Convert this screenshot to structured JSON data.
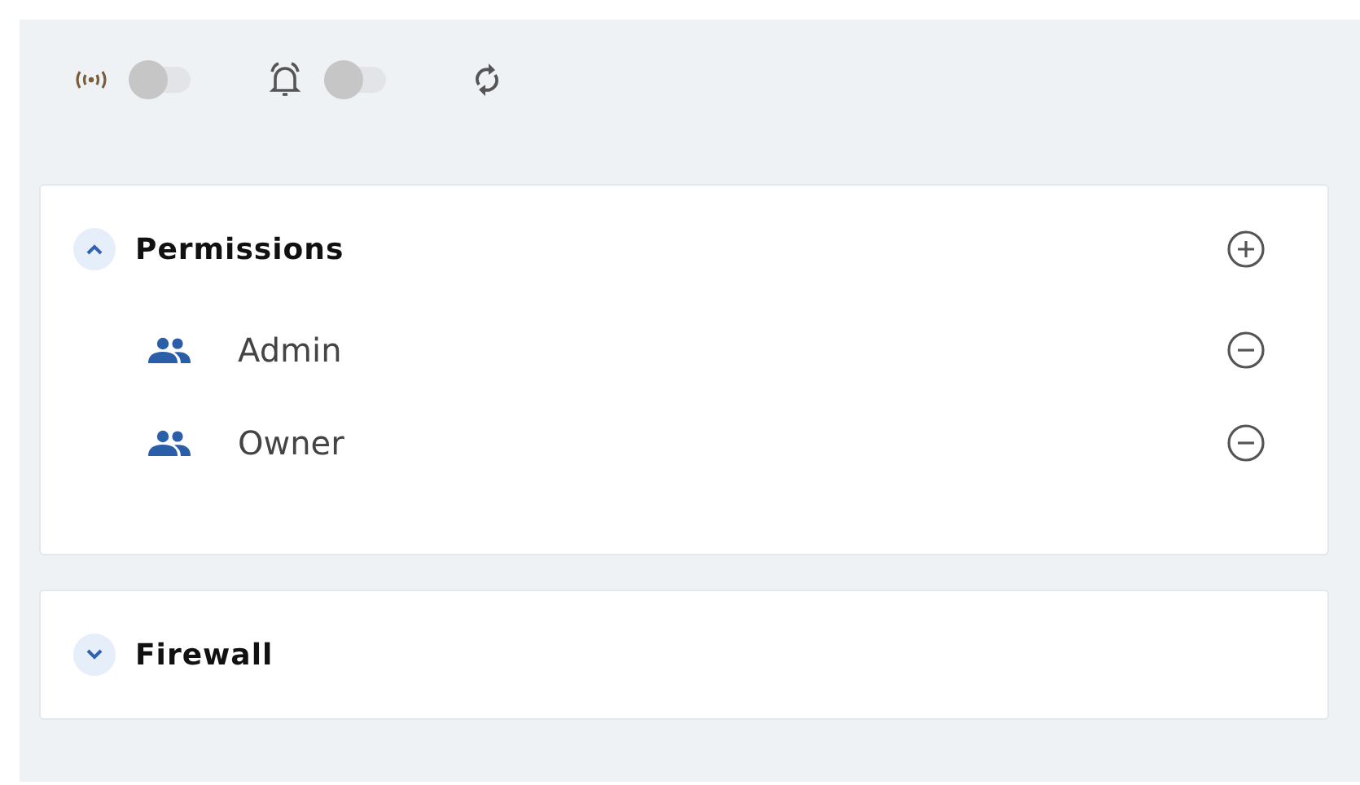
{
  "toolbar": {
    "toggles": [
      {
        "kind": "broadcast",
        "on": false
      },
      {
        "kind": "bell",
        "on": false
      }
    ]
  },
  "sections": [
    {
      "title": "Permissions",
      "expanded": true,
      "items": [
        {
          "label": "Admin"
        },
        {
          "label": "Owner"
        }
      ]
    },
    {
      "title": "Firewall",
      "expanded": false
    }
  ]
}
